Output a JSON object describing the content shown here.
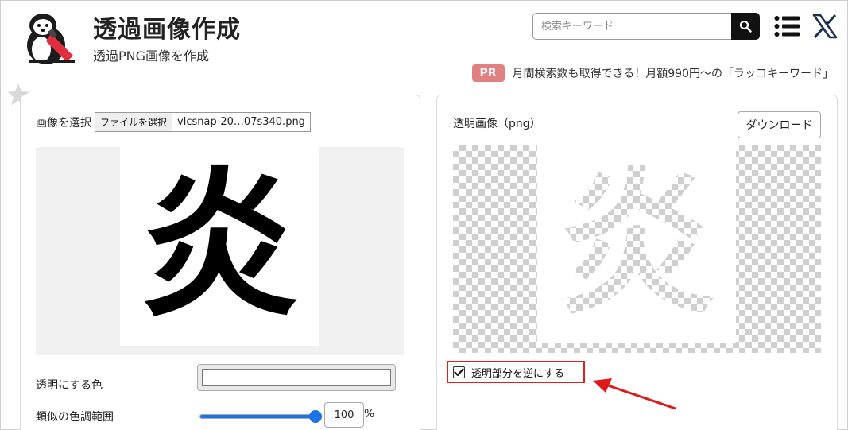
{
  "header": {
    "title": "透過画像作成",
    "subtitle": "透過PNG画像を作成"
  },
  "search": {
    "placeholder": "検索キーワード",
    "button_icon": "search-icon"
  },
  "nav_icons": [
    "menu-icon",
    "x-logo-icon"
  ],
  "ad": {
    "badge": "PR",
    "text": "月間検索数も取得できる！月額990円〜の「ラッコキーワード」"
  },
  "left_panel": {
    "file_label": "画像を選択",
    "file_button": "ファイルを選択",
    "file_name": "vlcsnap-20…07s340.png",
    "preview_char": "炎",
    "transparent_color_label": "透明にする色",
    "similar_range_label": "類似の色調範囲",
    "range_value": "100",
    "range_unit": "%"
  },
  "right_panel": {
    "title": "透明画像（png）",
    "download_button": "ダウンロード",
    "preview_char": "炎",
    "invert_label": "透明部分を逆にする",
    "invert_checked": true
  },
  "colors": {
    "accent": "#1a73e8",
    "pr_badge": "#e08080",
    "highlight": "#e02020"
  }
}
